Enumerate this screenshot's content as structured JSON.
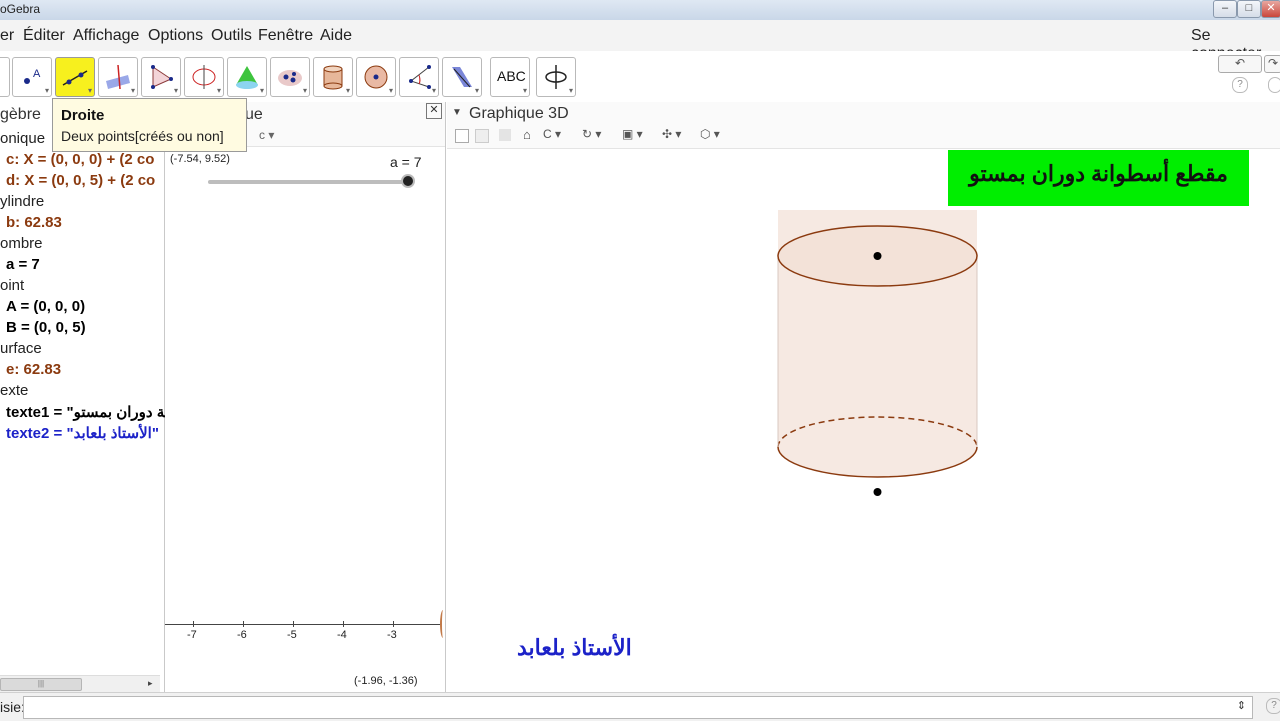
{
  "window": {
    "title": "oGebra",
    "minimize": "–",
    "maximize": "□",
    "close": "✕"
  },
  "menu": {
    "items": [
      "er",
      "Éditer",
      "Affichage",
      "Options",
      "Outils",
      "Fenêtre",
      "Aide"
    ],
    "sign_in": "Se connecter"
  },
  "toolbar": {
    "tools": [
      "move-tool",
      "point-tool",
      "line-tool",
      "perpendicular-tool",
      "polygon-tool",
      "circle-tool",
      "cone-tool",
      "intersect-tool",
      "cylinder-tool",
      "sphere-tool",
      "angle-tool",
      "reflect-tool",
      "text-tool",
      "rotate-view-tool"
    ],
    "text_tool_label": "ABC",
    "undo": "↶",
    "redo": "↷",
    "help": "?"
  },
  "tooltip": {
    "title": "Droite",
    "subtitle": "Deux points[créés ou non]"
  },
  "algebra": {
    "header": "gèbre",
    "lines": [
      {
        "text": "onique",
        "style": "cat"
      },
      {
        "text": "c: X = (0, 0, 0) + (2 co",
        "style": "brown"
      },
      {
        "text": "d: X = (0, 0, 5) + (2 co",
        "style": "brown"
      },
      {
        "text": "ylindre",
        "style": "cat"
      },
      {
        "text": "b: 62.83",
        "style": "brown"
      },
      {
        "text": "ombre",
        "style": "cat"
      },
      {
        "text": "a = 7",
        "style": "black"
      },
      {
        "text": "oint",
        "style": "cat"
      },
      {
        "text": "A = (0, 0, 0)",
        "style": "black"
      },
      {
        "text": "B = (0, 0, 5)",
        "style": "black"
      },
      {
        "text": "urface",
        "style": "cat"
      },
      {
        "text": "e: 62.83",
        "style": "brown"
      },
      {
        "text": "exte",
        "style": "cat"
      },
      {
        "text": "texte1 = \"نة دوران بمستو",
        "style": "black"
      },
      {
        "text": "texte2 = \"الأستاذ بلعابد\"",
        "style": "blue"
      }
    ]
  },
  "graphics2d": {
    "header_partial": "ue",
    "coord_top": "(-7.54, 9.52)",
    "coord_bottom": "(-1.96, -1.36)",
    "slider_label": "a = 7",
    "slider_value": 7,
    "x_ticks": [
      "-7",
      "-6",
      "-5",
      "-4",
      "-3"
    ]
  },
  "graphics3d": {
    "header": "Graphique 3D",
    "title_text": "مقطع أسطوانة دوران بمستو",
    "author_text": "الأستاذ بلعابد",
    "title_bg": "#00ee00",
    "author_color": "#1c22c8"
  },
  "input_bar": {
    "label": "isie:",
    "help": "?"
  }
}
